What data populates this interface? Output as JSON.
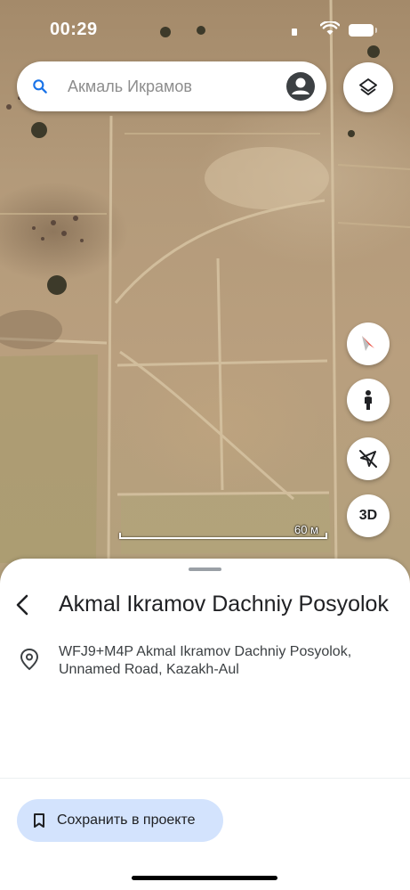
{
  "status_bar": {
    "time": "00:29"
  },
  "search": {
    "text": "Акмаль Икрамов"
  },
  "map": {
    "scale_label": "60 м",
    "three_d_label": "3D"
  },
  "place": {
    "title": "Akmal Ikramov Dachniy Posyolok",
    "address": "WFJ9+M4P Akmal Ikramov Dachniy Posyolok, Unnamed Road, Kazakh-Aul"
  },
  "actions": {
    "save_label": "Сохранить в проекте"
  },
  "colors": {
    "accent": "#1a73e8",
    "save_bg": "#d3e3fd",
    "compass_red": "#ea4335"
  }
}
